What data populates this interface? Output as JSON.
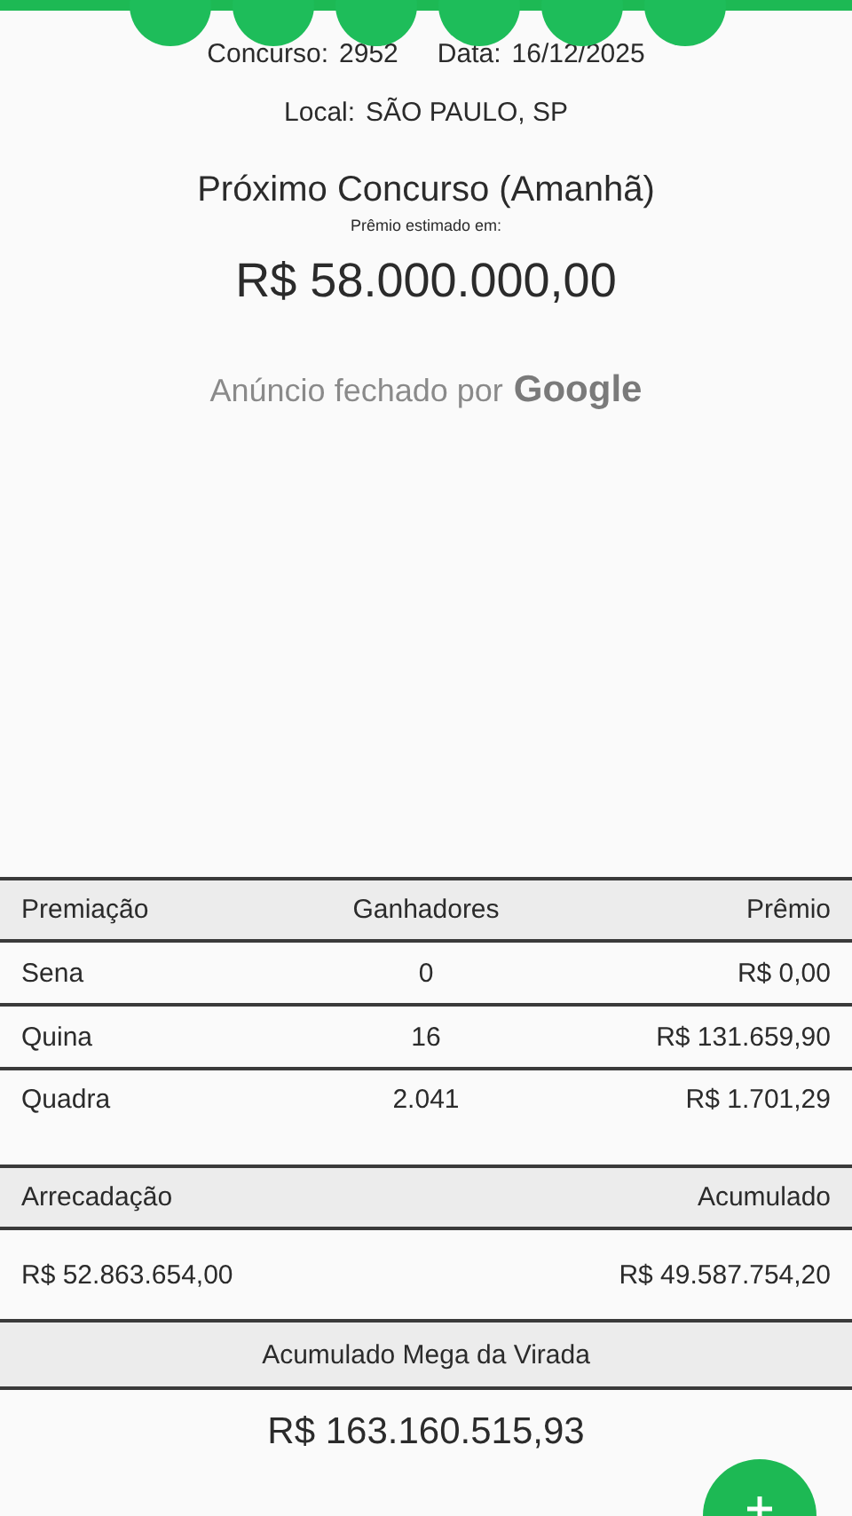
{
  "drawn_balls": [
    {
      "kind": "ball"
    },
    {
      "kind": "ball"
    },
    {
      "kind": "ball"
    },
    {
      "kind": "ball"
    },
    {
      "kind": "ball"
    },
    {
      "kind": "ball"
    }
  ],
  "contest": {
    "number_label": "Concurso:",
    "number": "2952",
    "date_label": "Data:",
    "date": "16/12/2025",
    "place_label": "Local:",
    "place": "SÃO PAULO, SP"
  },
  "next_contest": {
    "title": "Próximo Concurso (Amanhã)",
    "subtitle": "Prêmio estimado em:",
    "amount": "R$ 58.000.000,00"
  },
  "ad_notice": {
    "text": "Anúncio fechado por",
    "brand": "Google"
  },
  "prizes": {
    "columns": [
      "Premiação",
      "Ganhadores",
      "Prêmio"
    ],
    "rows": [
      [
        "Sena",
        "0",
        "R$ 0,00"
      ],
      [
        "Quina",
        "16",
        "R$ 131.659,90"
      ],
      [
        "Quadra",
        "2.041",
        "R$ 1.701,29"
      ]
    ]
  },
  "totals": {
    "columns": [
      "Arrecadação",
      "Acumulado"
    ],
    "values": [
      "R$ 52.863.654,00",
      "R$ 49.587.754,20"
    ]
  },
  "mega_virada": {
    "label": "Acumulado Mega da Virada",
    "amount": "R$ 163.160.515,93"
  }
}
